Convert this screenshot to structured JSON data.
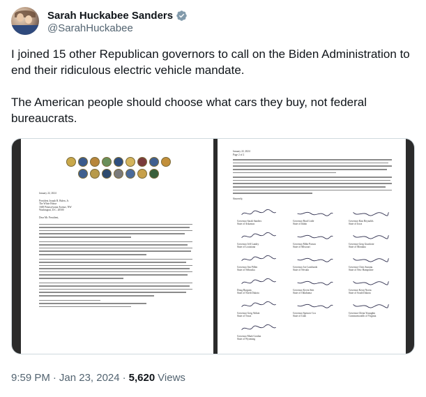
{
  "author": {
    "display_name": "Sarah Huckabee Sanders",
    "handle": "@SarahHuckabee",
    "verified_color": "#829aab"
  },
  "tweet": {
    "paragraph_1": "I joined 15 other Republican governors to call on the Biden Administration to end their ridiculous electric vehicle mandate.",
    "paragraph_2": "The American people should choose what cars they buy, not federal bureaucrats."
  },
  "media": {
    "page1": {
      "date": "January 22, 2024",
      "address": [
        "President Joseph R. Biden, Jr.",
        "The White House",
        "1600 Pennsylvania Avenue, NW",
        "Washington, D.C. 20500"
      ],
      "salutation": "Dear Mr. President,"
    },
    "page2": {
      "header": [
        "January 22, 2024",
        "Page 2 of 2"
      ],
      "closing": "Sincerely,",
      "signatories": [
        [
          "Governor Sarah Sanders",
          "State of Arkansas"
        ],
        [
          "Governor Brad Little",
          "State of Idaho"
        ],
        [
          "Governor Kim Reynolds",
          "State of Iowa"
        ],
        [
          "Governor Jeff Landry",
          "State of Louisiana"
        ],
        [
          "Governor Mike Parson",
          "State of Missouri"
        ],
        [
          "Governor Greg Gianforte",
          "State of Montana"
        ],
        [
          "Governor Jim Pillen",
          "State of Nebraska"
        ],
        [
          "Governor Joe Lombardo",
          "State of Nevada"
        ],
        [
          "Governor Chris Sununu",
          "State of New Hampshire"
        ],
        [
          "Doug Burgum",
          "State of North Dakota"
        ],
        [
          "Governor Kevin Stitt",
          "State of Oklahoma"
        ],
        [
          "Governor Kristi Noem",
          "State of South Dakota"
        ],
        [
          "Governor Greg Abbott",
          "State of Texas"
        ],
        [
          "Governor Spencer Cox",
          "State of Utah"
        ],
        [
          "Governor Glenn Youngkin",
          "Commonwealth of Virginia"
        ],
        [
          "Governor Mark Gordon",
          "State of Wyoming"
        ]
      ]
    }
  },
  "meta": {
    "time": "9:59 PM",
    "separator": "·",
    "date": "Jan 23, 2024",
    "views_count": "5,620",
    "views_label": "Views"
  }
}
